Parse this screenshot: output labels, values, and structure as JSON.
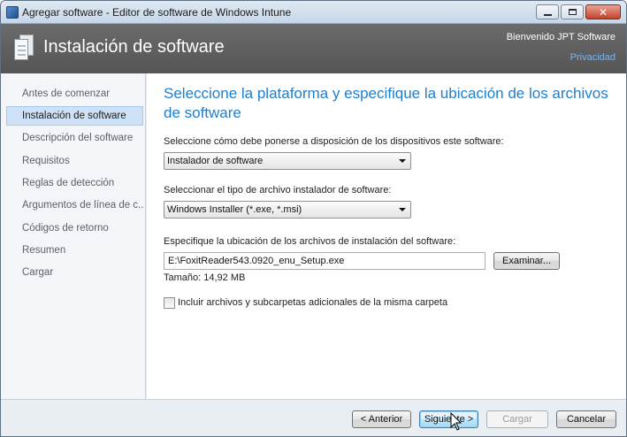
{
  "window": {
    "title": "Agregar software - Editor de software de Windows Intune",
    "icons": {
      "app": "window-app-icon",
      "minimize": "minimize-icon",
      "maximize": "maximize-icon",
      "close": "close-icon"
    }
  },
  "header": {
    "title": "Instalación de software",
    "welcome": "Bienvenido JPT Software",
    "privacy_link": "Privacidad",
    "icon": "software-pages-icon"
  },
  "sidebar": {
    "items": [
      {
        "label": "Antes de comenzar",
        "active": false
      },
      {
        "label": "Instalación de software",
        "active": true
      },
      {
        "label": "Descripción del software",
        "active": false
      },
      {
        "label": "Requisitos",
        "active": false
      },
      {
        "label": "Reglas de detección",
        "active": false
      },
      {
        "label": "Argumentos de línea de c...",
        "active": false
      },
      {
        "label": "Códigos de retorno",
        "active": false
      },
      {
        "label": "Resumen",
        "active": false
      },
      {
        "label": "Cargar",
        "active": false
      }
    ]
  },
  "main": {
    "heading": "Seleccione la plataforma y especifique la ubicación de los archivos de software",
    "availability_label": "Seleccione cómo debe ponerse a disposición de los dispositivos este software:",
    "availability_value": "Instalador de software",
    "installer_type_label": "Seleccionar el tipo de archivo instalador de software:",
    "installer_type_value": "Windows Installer (*.exe, *.msi)",
    "location_label": "Especifique la ubicación de los archivos de instalación del software:",
    "location_value": "E:\\FoxitReader543.0920_enu_Setup.exe",
    "browse_button": "Examinar...",
    "size_text": "Tamaño: 14,92 MB",
    "include_checkbox_label": "Incluir archivos y subcarpetas adicionales de la misma carpeta",
    "include_checked": false
  },
  "footer": {
    "back_button": "< Anterior",
    "next_button": "Siguiente >",
    "upload_button": "Cargar",
    "cancel_button": "Cancelar"
  },
  "colors": {
    "heading_accent": "#1f7dcf",
    "header_bg": "#5e5e5e",
    "selection_bg": "#cde2f6",
    "link": "#7fb3ea"
  }
}
